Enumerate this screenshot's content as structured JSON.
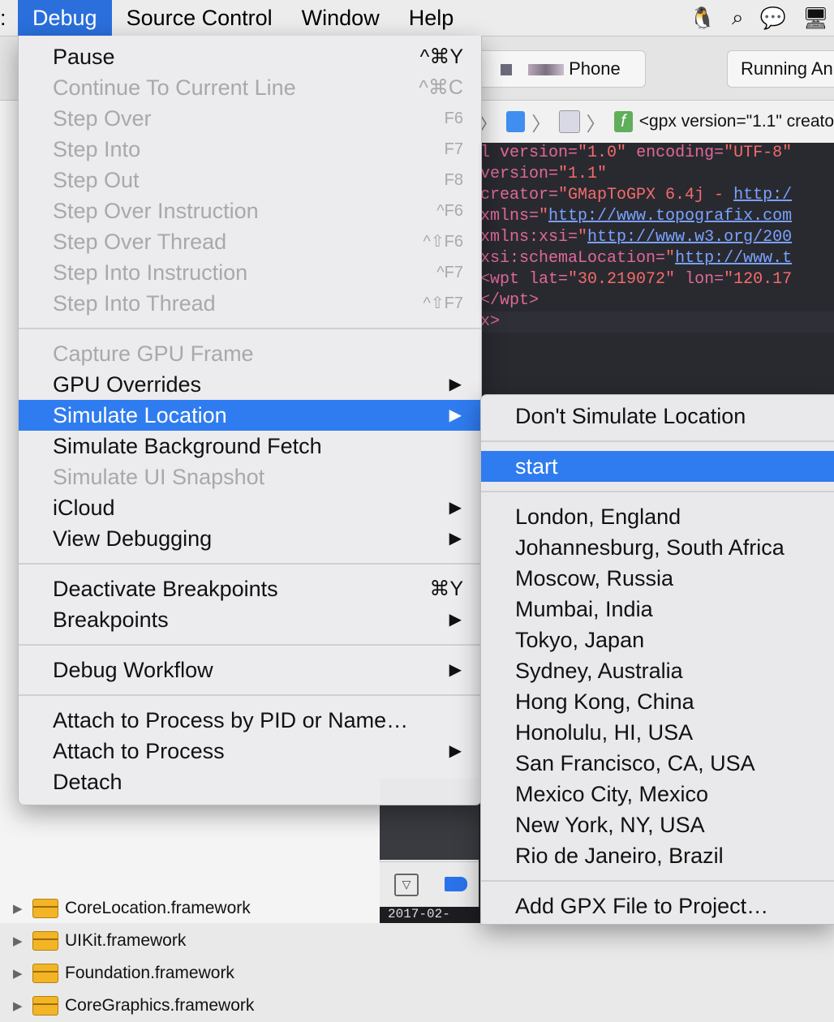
{
  "menubar": {
    "items": [
      "Debug",
      "Source Control",
      "Window",
      "Help"
    ],
    "active": "Debug"
  },
  "toolbar": {
    "scheme_device": "Phone",
    "status": "Running An"
  },
  "jumpbar": {
    "path_text": "<gpx version=\"1.1\" creato"
  },
  "editor": {
    "lines": [
      [
        [
          "c-attr",
          "l version="
        ],
        [
          "c-str",
          "\"1.0\""
        ],
        [
          "c-plain",
          " "
        ],
        [
          "c-attr",
          "encoding="
        ],
        [
          "c-str",
          "\"UTF-8\""
        ]
      ],
      [
        [
          "c-attr",
          " version="
        ],
        [
          "c-str",
          "\"1.1\""
        ]
      ],
      [
        [
          "c-attr",
          "creator="
        ],
        [
          "c-str",
          "\"GMapToGPX 6.4j - "
        ],
        [
          "c-url",
          "http:/"
        ]
      ],
      [
        [
          "c-attr",
          "xmlns="
        ],
        [
          "c-str",
          "\""
        ],
        [
          "c-url",
          "http://www.topografix.com"
        ]
      ],
      [
        [
          "c-attr",
          "xmlns:xsi="
        ],
        [
          "c-str",
          "\""
        ],
        [
          "c-url",
          "http://www.w3.org/200"
        ]
      ],
      [
        [
          "c-attr",
          "xsi:schemaLocation="
        ],
        [
          "c-str",
          "\""
        ],
        [
          "c-url",
          "http://www.t"
        ]
      ],
      [
        [
          "c-tag",
          "<wpt "
        ],
        [
          "c-attr",
          "lat="
        ],
        [
          "c-str",
          "\"30.219072\""
        ],
        [
          "c-plain",
          " "
        ],
        [
          "c-attr",
          "lon="
        ],
        [
          "c-str",
          "\"120.17"
        ]
      ],
      [
        [
          "c-tag",
          "</wpt>"
        ]
      ],
      [
        [
          "c-tag",
          "x>"
        ]
      ]
    ]
  },
  "navigator": {
    "rows": [
      "CoreLocation.framework",
      "UIKit.framework",
      "Foundation.framework",
      "CoreGraphics.framework"
    ]
  },
  "console": {
    "text": "2017-02-"
  },
  "debug_menu": {
    "items": [
      {
        "label": "Pause",
        "shortcut": "^⌘Y",
        "disabled": false
      },
      {
        "label": "Continue To Current Line",
        "shortcut": "^⌘C",
        "disabled": true
      },
      {
        "label": "Step Over",
        "shortcut": "F6",
        "disabled": true
      },
      {
        "label": "Step Into",
        "shortcut": "F7",
        "disabled": true
      },
      {
        "label": "Step Out",
        "shortcut": "F8",
        "disabled": true
      },
      {
        "label": "Step Over Instruction",
        "shortcut": "^F6",
        "disabled": true
      },
      {
        "label": "Step Over Thread",
        "shortcut": "^⇧F6",
        "disabled": true
      },
      {
        "label": "Step Into Instruction",
        "shortcut": "^F7",
        "disabled": true
      },
      {
        "label": "Step Into Thread",
        "shortcut": "^⇧F7",
        "disabled": true
      },
      {
        "label": "Capture GPU Frame",
        "disabled": true
      },
      {
        "label": "GPU Overrides",
        "submenu": true
      },
      {
        "label": "Simulate Location",
        "submenu": true,
        "selected": true
      },
      {
        "label": "Simulate Background Fetch"
      },
      {
        "label": "Simulate UI Snapshot",
        "disabled": true
      },
      {
        "label": "iCloud",
        "submenu": true
      },
      {
        "label": "View Debugging",
        "submenu": true
      },
      {
        "label": "Deactivate Breakpoints",
        "shortcut": "⌘Y"
      },
      {
        "label": "Breakpoints",
        "submenu": true
      },
      {
        "label": "Debug Workflow",
        "submenu": true
      },
      {
        "label": "Attach to Process by PID or Name…"
      },
      {
        "label": "Attach to Process",
        "submenu": true
      },
      {
        "label": "Detach"
      }
    ]
  },
  "location_submenu": {
    "dont_simulate": "Don't Simulate Location",
    "custom": "start",
    "locations": [
      "London, England",
      "Johannesburg, South Africa",
      "Moscow, Russia",
      "Mumbai, India",
      "Tokyo, Japan",
      "Sydney, Australia",
      "Hong Kong, China",
      "Honolulu, HI, USA",
      "San Francisco, CA, USA",
      "Mexico City, Mexico",
      "New York, NY, USA",
      "Rio de Janeiro, Brazil"
    ],
    "add_gpx": "Add GPX File to Project…"
  },
  "colors": {
    "accent": "#2f7cf0",
    "menubar_active": "#2a6fdc",
    "editor_bg": "#292a30"
  },
  "icons": [
    "apple-stub",
    "qq-icon",
    "search-icon",
    "wechat-icon",
    "display-icon"
  ]
}
